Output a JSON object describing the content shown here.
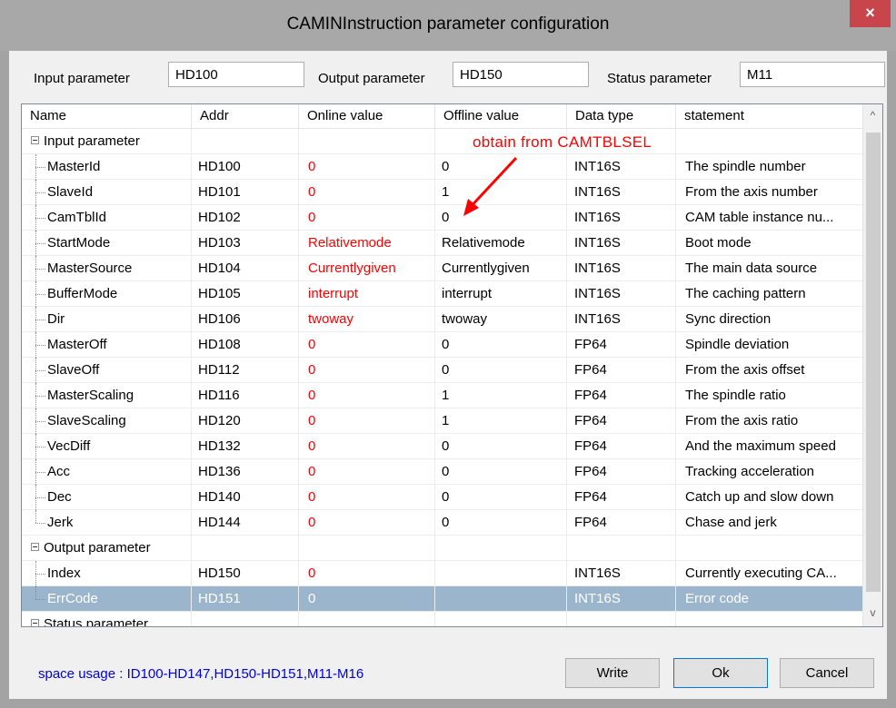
{
  "window": {
    "title": "CAMINInstruction parameter configuration",
    "close_glyph": "×"
  },
  "params": {
    "input_label": "Input parameter",
    "input_value": "HD100",
    "output_label": "Output parameter",
    "output_value": "HD150",
    "status_label": "Status parameter",
    "status_value": "M11"
  },
  "grid": {
    "headers": [
      "Name",
      "Addr",
      "Online value",
      "Offline value",
      "Data type",
      "statement"
    ],
    "groups": {
      "input": "Input parameter",
      "output": "Output parameter",
      "status": "Status parameter"
    },
    "input_rows": [
      {
        "name": "MasterId",
        "addr": "HD100",
        "online": "0",
        "offline": "0",
        "type": "INT16S",
        "statement": "The spindle number"
      },
      {
        "name": "SlaveId",
        "addr": "HD101",
        "online": "0",
        "offline": "1",
        "type": "INT16S",
        "statement": "From the axis number"
      },
      {
        "name": "CamTblId",
        "addr": "HD102",
        "online": "0",
        "offline": "0",
        "type": "INT16S",
        "statement": "CAM table instance nu..."
      },
      {
        "name": "StartMode",
        "addr": "HD103",
        "online": "Relativemode",
        "offline": "Relativemode",
        "type": "INT16S",
        "statement": "Boot mode"
      },
      {
        "name": "MasterSource",
        "addr": "HD104",
        "online": "Currentlygiven",
        "offline": "Currentlygiven",
        "type": "INT16S",
        "statement": "The main data source"
      },
      {
        "name": "BufferMode",
        "addr": "HD105",
        "online": "interrupt",
        "offline": "interrupt",
        "type": "INT16S",
        "statement": "The caching pattern"
      },
      {
        "name": "Dir",
        "addr": "HD106",
        "online": "twoway",
        "offline": "twoway",
        "type": "INT16S",
        "statement": "Sync direction"
      },
      {
        "name": "MasterOff",
        "addr": "HD108",
        "online": "0",
        "offline": "0",
        "type": "FP64",
        "statement": "Spindle deviation"
      },
      {
        "name": "SlaveOff",
        "addr": "HD112",
        "online": "0",
        "offline": "0",
        "type": "FP64",
        "statement": "From the axis offset"
      },
      {
        "name": "MasterScaling",
        "addr": "HD116",
        "online": "0",
        "offline": "1",
        "type": "FP64",
        "statement": "The spindle ratio"
      },
      {
        "name": "SlaveScaling",
        "addr": "HD120",
        "online": "0",
        "offline": "1",
        "type": "FP64",
        "statement": "From the axis ratio"
      },
      {
        "name": "VecDiff",
        "addr": "HD132",
        "online": "0",
        "offline": "0",
        "type": "FP64",
        "statement": "And the maximum speed"
      },
      {
        "name": "Acc",
        "addr": "HD136",
        "online": "0",
        "offline": "0",
        "type": "FP64",
        "statement": "Tracking acceleration"
      },
      {
        "name": "Dec",
        "addr": "HD140",
        "online": "0",
        "offline": "0",
        "type": "FP64",
        "statement": "Catch up and slow down"
      },
      {
        "name": "Jerk",
        "addr": "HD144",
        "online": "0",
        "offline": "0",
        "type": "FP64",
        "statement": "Chase and jerk"
      }
    ],
    "output_rows": [
      {
        "name": "Index",
        "addr": "HD150",
        "online": "0",
        "offline": "",
        "type": "INT16S",
        "statement": "Currently executing CA..."
      },
      {
        "name": "ErrCode",
        "addr": "HD151",
        "online": "0",
        "offline": "",
        "type": "INT16S",
        "statement": "Error code"
      }
    ],
    "scroll_up_glyph": "^",
    "scroll_down_glyph": "v"
  },
  "annotation": "obtain from CAMTBLSEL",
  "footer": {
    "usage": "space usage : ID100-HD147,HD150-HD151,M11-M16",
    "write_label": "Write",
    "ok_label": "Ok",
    "cancel_label": "Cancel"
  },
  "colors": {
    "online_value": "#ff0000",
    "annotation": "#ff0000",
    "usage_text": "#0000dd",
    "selected_row": "#9bb6cc",
    "close_button": "#c8454b"
  }
}
